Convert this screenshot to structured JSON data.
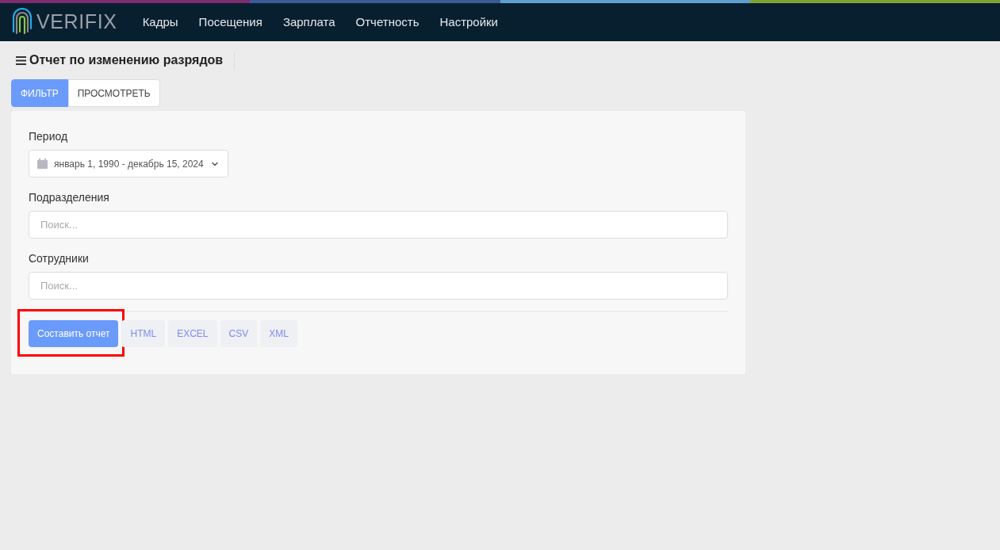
{
  "navbar": {
    "logo": "VERIFIX",
    "menu": [
      {
        "label": "Кадры"
      },
      {
        "label": "Посещения"
      },
      {
        "label": "Зарплата"
      },
      {
        "label": "Отчетность"
      },
      {
        "label": "Настройки"
      }
    ]
  },
  "page": {
    "title": "Отчет по изменению разрядов"
  },
  "tabs": [
    {
      "label": "ФИЛЬТР",
      "selected": true
    },
    {
      "label": "ПРОСМОТРЕТЬ",
      "selected": false
    }
  ],
  "form": {
    "period": {
      "label": "Период",
      "value": "январь 1, 1990 - декабрь 15, 2024"
    },
    "fields": [
      {
        "label": "Подразделения",
        "placeholder": "Поиск..."
      },
      {
        "label": "Сотрудники",
        "placeholder": "Поиск..."
      }
    ],
    "buttons": [
      {
        "label": "Составить отчет",
        "kind": "primary",
        "highlighted": true
      },
      {
        "label": "HTML",
        "kind": "format",
        "highlighted": false
      },
      {
        "label": "EXCEL",
        "kind": "format",
        "highlighted": false
      },
      {
        "label": "CSV",
        "kind": "format",
        "highlighted": false
      },
      {
        "label": "XML",
        "kind": "format",
        "highlighted": false
      }
    ]
  }
}
